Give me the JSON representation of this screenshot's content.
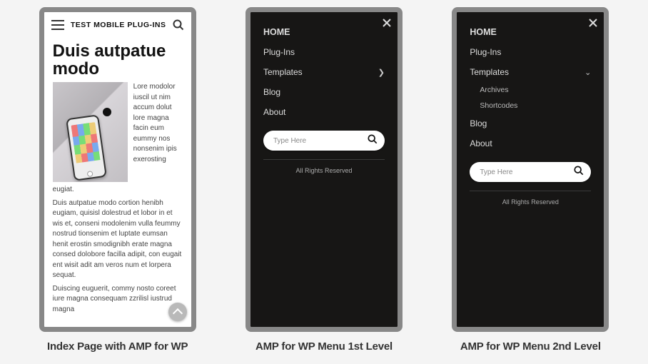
{
  "captions": {
    "panel1": "Index Page with AMP for WP",
    "panel2": "AMP for WP Menu 1st Level",
    "panel3": "AMP for WP Menu 2nd Level"
  },
  "panel1": {
    "site_title": "TEST MOBILE PLUG-INS",
    "headline": "Duis autpatue modo",
    "side_text": "Lore modolor iuscil ut nim accum dolut lore magna facin eum eummy nos nonsenim ipis exerosting",
    "para1": "eugiat.",
    "para2": "Duis autpatue modo cortion henibh eugiam, quisisl dolestrud et lobor in et wis et, conseni modolenim vulla feummy nostrud tionsenim et luptate eumsan henit erostin smodignibh erate magna consed dolobore facilla adipit, con eugait ent wisit adit am veros num et lorpera sequat.",
    "para3": "Duiscing euguerit, commy nosto coreet iure magna consequam zzrilisl iustrud magna"
  },
  "menu": {
    "home_label": "HOME",
    "items": {
      "plugins": "Plug-Ins",
      "templates": "Templates",
      "blog": "Blog",
      "about": "About"
    },
    "submenu": {
      "archives": "Archives",
      "shortcodes": "Shortcodes"
    },
    "search_placeholder": "Type Here",
    "rights": "All Rights Reserved"
  }
}
